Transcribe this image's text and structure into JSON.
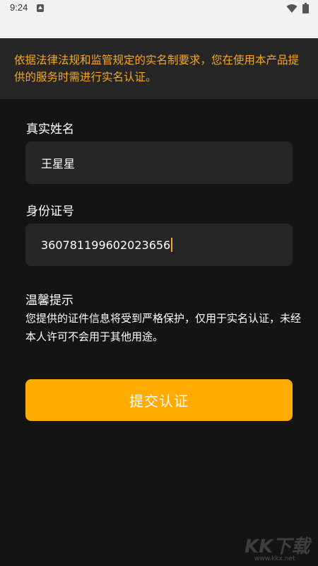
{
  "status_bar": {
    "time": "9:24"
  },
  "notice": {
    "text": "依据法律法规和监管规定的实名制要求，您在使用本产品提供的服务时需进行实名认证。",
    "color": "#f5a623"
  },
  "form": {
    "name_label": "真实姓名",
    "name_value": "王星星",
    "id_label": "身份证号",
    "id_value": "360781199602023656"
  },
  "tips": {
    "title": "温馨提示",
    "body": "您提供的证件信息将受到严格保护，仅用于实名认证，未经本人许可不会用于其他用途。"
  },
  "submit": {
    "label": "提交认证",
    "color": "#ffab00"
  },
  "watermark": {
    "logo": "KK下载",
    "url": "www.kkx.net"
  }
}
